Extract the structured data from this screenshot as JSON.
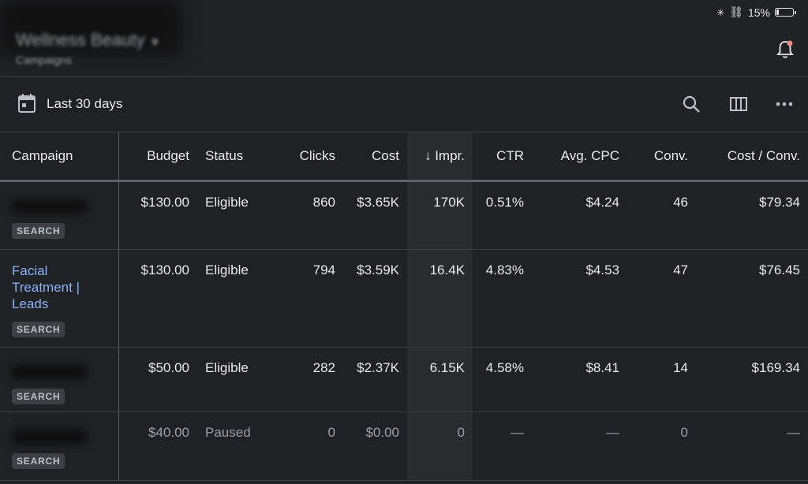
{
  "status_bar": {
    "battery": "15%",
    "battery_level": 0.15
  },
  "header": {
    "account_name": "Wellness Beauty",
    "subtitle": "Campaigns"
  },
  "toolbar": {
    "date_range": "Last 30 days"
  },
  "table": {
    "columns": [
      "Campaign",
      "Budget",
      "Status",
      "Clicks",
      "Cost",
      "↓ Impr.",
      "CTR",
      "Avg. CPC",
      "Conv.",
      "Cost / Conv."
    ],
    "rows": [
      {
        "name": "",
        "type": "SEARCH",
        "budget": "$130.00",
        "status": "Eligible",
        "clicks": "860",
        "cost": "$3.65K",
        "impr": "170K",
        "ctr": "0.51%",
        "avg_cpc": "$4.24",
        "conv": "46",
        "cost_conv": "$79.34"
      },
      {
        "name": "Facial Treatment | Leads",
        "type": "SEARCH",
        "budget": "$130.00",
        "status": "Eligible",
        "clicks": "794",
        "cost": "$3.59K",
        "impr": "16.4K",
        "ctr": "4.83%",
        "avg_cpc": "$4.53",
        "conv": "47",
        "cost_conv": "$76.45"
      },
      {
        "name": "",
        "type": "SEARCH",
        "budget": "$50.00",
        "status": "Eligible",
        "clicks": "282",
        "cost": "$2.37K",
        "impr": "6.15K",
        "ctr": "4.58%",
        "avg_cpc": "$8.41",
        "conv": "14",
        "cost_conv": "$169.34"
      },
      {
        "name": "",
        "type": "SEARCH",
        "budget": "$40.00",
        "status": "Paused",
        "clicks": "0",
        "cost": "$0.00",
        "impr": "0",
        "ctr": "—",
        "avg_cpc": "—",
        "conv": "0",
        "cost_conv": "—"
      }
    ]
  }
}
